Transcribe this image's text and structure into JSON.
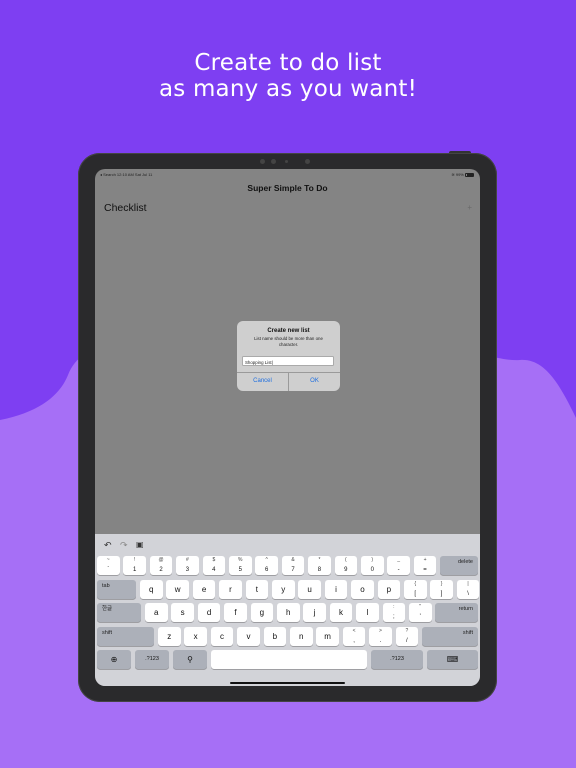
{
  "headline": {
    "line1": "Create to do list",
    "line2": "as many as you want!"
  },
  "colors": {
    "background_top": "#7e3ff2",
    "background_wave": "#a66ff6",
    "device": "#2a2a2c",
    "accent": "#1f6fe0"
  },
  "statusbar": {
    "left": "◂ Search   12:10 AM   Sat Jul 11",
    "right": "99%"
  },
  "app": {
    "title": "Super Simple To Do",
    "list_header": "Checklist",
    "add_icon": "plus-icon"
  },
  "dialog": {
    "title": "Create new list",
    "message": "List name should be more than one character.",
    "input_value": "Shopping List|",
    "cancel_label": "Cancel",
    "ok_label": "OK"
  },
  "keyboard": {
    "toolbar_icons": [
      "undo-icon",
      "redo-icon",
      "paste-icon"
    ],
    "row1": [
      {
        "top": "~",
        "bot": "`"
      },
      {
        "top": "!",
        "bot": "1"
      },
      {
        "top": "@",
        "bot": "2"
      },
      {
        "top": "#",
        "bot": "3"
      },
      {
        "top": "$",
        "bot": "4"
      },
      {
        "top": "%",
        "bot": "5"
      },
      {
        "top": "^",
        "bot": "6"
      },
      {
        "top": "&",
        "bot": "7"
      },
      {
        "top": "*",
        "bot": "8"
      },
      {
        "top": "(",
        "bot": "9"
      },
      {
        "top": ")",
        "bot": "0"
      },
      {
        "top": "_",
        "bot": "-"
      },
      {
        "top": "+",
        "bot": "="
      }
    ],
    "delete_label": "delete",
    "tab_label": "tab",
    "row2": [
      "q",
      "w",
      "e",
      "r",
      "t",
      "y",
      "u",
      "i",
      "o",
      "p"
    ],
    "row2_extra": [
      {
        "top": "{",
        "bot": "["
      },
      {
        "top": "}",
        "bot": "]"
      },
      {
        "top": "|",
        "bot": "\\"
      }
    ],
    "lang_label": "한글",
    "row3": [
      "a",
      "s",
      "d",
      "f",
      "g",
      "h",
      "j",
      "k",
      "l"
    ],
    "row3_extra": [
      {
        "top": ":",
        "bot": ";"
      },
      {
        "top": "\"",
        "bot": "'"
      }
    ],
    "return_label": "return",
    "shift_label": "shift",
    "row4": [
      "z",
      "x",
      "c",
      "v",
      "b",
      "n",
      "m"
    ],
    "row4_extra": [
      {
        "top": "<",
        "bot": ","
      },
      {
        "top": ">",
        "bot": "."
      },
      {
        "top": "?",
        "bot": "/"
      }
    ],
    "numbers_label": ".?123",
    "globe_icon": "globe-icon",
    "mic_icon": "mic-icon",
    "dismiss_icon": "keyboard-dismiss-icon"
  }
}
